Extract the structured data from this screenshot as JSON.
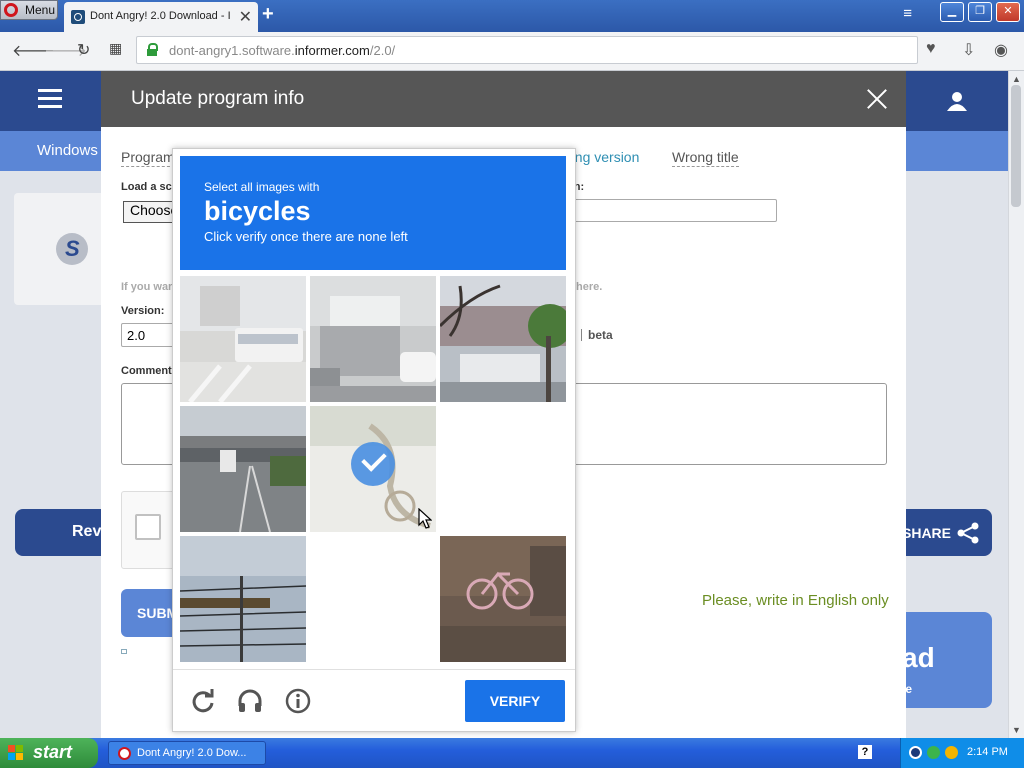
{
  "browser": {
    "menu_label": "Menu",
    "tab_title": "Dont Angry! 2.0 Download - I",
    "url_prefix": "dont-angry1.software.",
    "url_domain": "informer.com",
    "url_path": "/2.0/"
  },
  "site": {
    "category_label": "Windows",
    "review_label": "Rev",
    "share_label": "SHARE",
    "download_big": "ad",
    "download_small": "le"
  },
  "modal": {
    "title": "Update program info",
    "tabs": [
      {
        "label": "Program"
      },
      {
        "label": "ong version"
      },
      {
        "label": "Wrong title"
      }
    ],
    "load_label": "Load a scr",
    "load_right_label": "on:",
    "choose_label": "Choose",
    "hint_left": "If you war",
    "hint_right": "here.",
    "version_label": "Version:",
    "version_value": "2.0",
    "beta_label": "beta",
    "comment_label": "Comment",
    "submit_label": "SUBM",
    "english_note": "Please, write in English only"
  },
  "captcha": {
    "line1": "Select all images with",
    "target": "bicycles",
    "line3": "Click verify once there are none left",
    "verify_label": "VERIFY",
    "tiles": [
      {
        "scene": "bus-street",
        "selected": false
      },
      {
        "scene": "truck-cars",
        "selected": false
      },
      {
        "scene": "tree-bus",
        "selected": false
      },
      {
        "scene": "highway",
        "selected": false
      },
      {
        "scene": "bicycle-faded",
        "selected": true
      },
      {
        "scene": "blank",
        "selected": false
      },
      {
        "scene": "power-lines",
        "selected": false
      },
      {
        "scene": "blank",
        "selected": false
      },
      {
        "scene": "bicycle-wall",
        "selected": false
      }
    ]
  },
  "taskbar": {
    "start_label": "start",
    "task_label": "Dont Angry! 2.0 Dow...",
    "clock": "2:14 PM"
  }
}
